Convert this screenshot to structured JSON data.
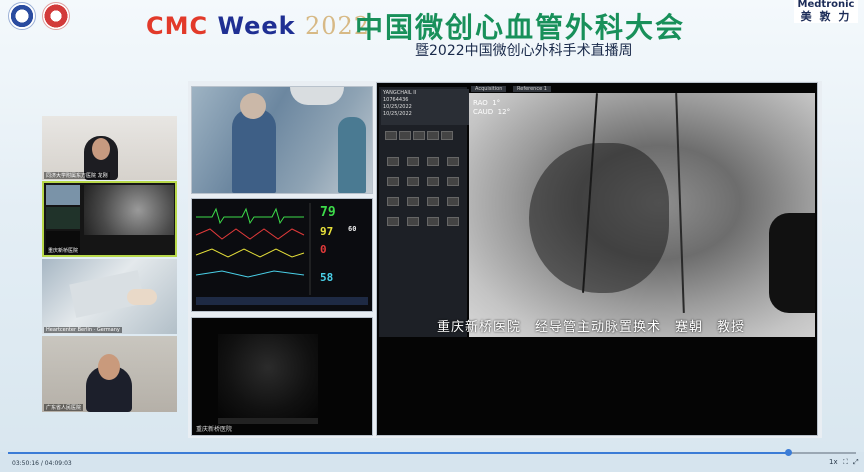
{
  "header": {
    "title_cmc": "CMC",
    "title_week": "Week",
    "title_year": "2022",
    "title_cn": "中国微创心血管外科大会",
    "subtitle": "暨2022中国微创心外科手术直播周",
    "sponsor_line1": "Medtronic",
    "sponsor_line2": "美 敦 力"
  },
  "thumbnails": [
    {
      "caption": "同济大学附属东方医院 龙刚"
    },
    {
      "caption": "重庆新桥医院"
    },
    {
      "caption": "Heartcenter Berlin · Germany"
    },
    {
      "caption": "广东省人民医院"
    }
  ],
  "fluoro": {
    "label_line1": "YANGCHAIL II",
    "label_line2": "10764436",
    "label_line3": "10/25/2022",
    "label_line4": "10/25/2022",
    "tab_acquisition": "Acquisition",
    "tab_reference": "Reference 1",
    "angle_label1": "RAO",
    "angle_value1": "1°",
    "angle_label2": "CAUD",
    "angle_value2": "12°",
    "overlay_caption": "重庆新桥医院　经导管主动脉置换术　蹇朝　教授"
  },
  "monitor": {
    "hr": "79",
    "spo2": "97",
    "abp": "0",
    "resp": "58",
    "nibp": "60"
  },
  "ultrasound": {
    "caption": "重庆新桥医院"
  },
  "player": {
    "time": "03:50:16 / 04:09:03",
    "progress": 0.92,
    "speed": "1x"
  }
}
